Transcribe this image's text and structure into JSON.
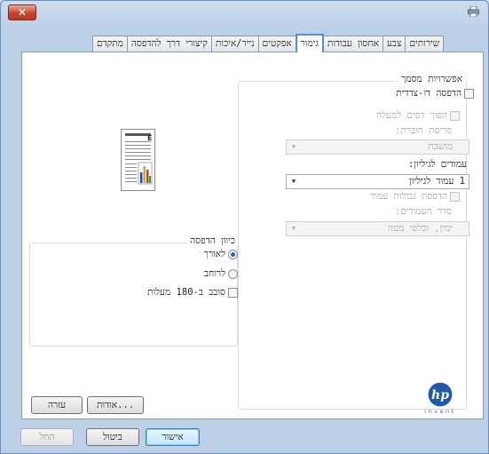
{
  "window": {
    "close_glyph": "✕",
    "system_icon": "printer-icon"
  },
  "tabs": [
    {
      "label": "מתקדם"
    },
    {
      "label": "קיצורי דרך להדפסה"
    },
    {
      "label": "נייר/איכות"
    },
    {
      "label": "אפקטים"
    },
    {
      "label": "גימור",
      "active": true
    },
    {
      "label": "אחסון עבודות"
    },
    {
      "label": "צבע"
    },
    {
      "label": "שירותים"
    }
  ],
  "doc_options": {
    "title": "אפשרויות מסמך",
    "duplex_label": "הדפסה דו-צדדית",
    "flip_pages_label": "הפוך דפים למעלה",
    "booklet_label": "פריסת חוברת:",
    "booklet_value": "מושבת",
    "pages_per_sheet_label": "עמודים לגיליון:",
    "pages_per_sheet_value": "1 עמוד לגיליון",
    "page_borders_label": "הדפסת גבולות עמוד",
    "page_order_label": "סדר העמודים:",
    "page_order_value": "ימין, וכלפי מטה"
  },
  "orientation": {
    "title": "כיוון הדפסה",
    "portrait_label": "לאורך",
    "landscape_label": "לרוחב",
    "rotate_label": "סובב ב-180 מעלות"
  },
  "buttons": {
    "about": "אודות...",
    "help": "עזרה",
    "ok": "אישור",
    "cancel": "ביטול",
    "apply": "החל"
  },
  "brand": {
    "logo_text": "hp",
    "tagline": "invent"
  },
  "colors": {
    "accent": "#4d90d6",
    "hp_blue": "#1e5aa8"
  }
}
